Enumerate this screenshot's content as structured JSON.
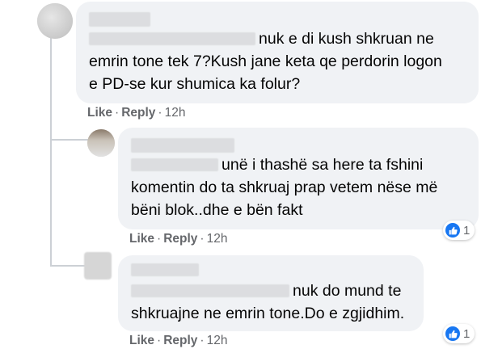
{
  "comments": [
    {
      "text": "nuk e di kush shkruan ne emrin tone tek 7?Kush jane keta qe perdorin logon e PD-se kur shumica ka folur?",
      "line1": "nuk e di kush shkruan ne",
      "line2": "emrin tone tek 7?Kush jane keta qe perdorin logon",
      "line3": "e PD-se kur shumica ka folur?",
      "like": "Like",
      "reply": "Reply",
      "time": "12h"
    },
    {
      "line1": "unë i thashë sa here ta fshini",
      "line2": "komentin do ta shkruaj prap vetem nëse më",
      "line3": "bëni blok..dhe e bën fakt",
      "like": "Like",
      "reply": "Reply",
      "time": "12h",
      "reaction_count": "1",
      "reaction_icon": "like-icon"
    },
    {
      "line1": "nuk do mund te",
      "line2": "shkruajne ne emrin tone.Do e zgjidhim.",
      "like": "Like",
      "reply": "Reply",
      "time": "12h",
      "reaction_count": "1",
      "reaction_icon": "like-icon"
    }
  ],
  "separator": "·",
  "colors": {
    "bubble": "#f0f2f5",
    "meta": "#65676b",
    "like_blue": "#1877f2"
  }
}
